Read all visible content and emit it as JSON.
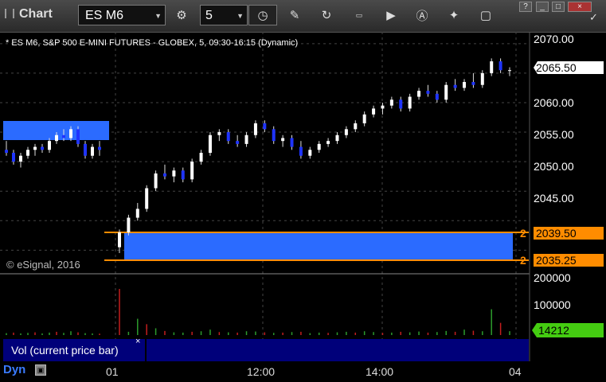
{
  "app": {
    "title": "Chart"
  },
  "toolbar": {
    "symbol": "ES M6",
    "interval": "5",
    "icons": [
      "settings-icon",
      "clock-icon",
      "draw-pencil-icon",
      "refresh-icon",
      "get-icon",
      "play-icon",
      "alert-icon",
      "tools-icon",
      "comment-icon",
      "twitter-icon"
    ]
  },
  "window_controls": [
    "?",
    "_",
    "□",
    "×"
  ],
  "chart": {
    "label": "* ES M6, S&P 500 E-MINI FUTURES - GLOBEX, 5, 09:30-16:15 (Dynamic)",
    "copyright": "© eSignal, 2016",
    "price_ticks": [
      "2070.00",
      "2060.00",
      "2055.00",
      "2050.00",
      "2045.00"
    ],
    "current_price": "2065.50",
    "order_upper": {
      "qty": "2",
      "price": "2039.50"
    },
    "order_lower": {
      "qty": "2",
      "price": "2035.25"
    },
    "vol_ticks": [
      "200000",
      "100000"
    ],
    "vol_current": "14212",
    "vol_study_label": "Vol (current price bar)",
    "vol_close_glyph": "×",
    "time_labels": [
      "01",
      "12:00",
      "14:00",
      "04"
    ],
    "dyn_label": "Dyn",
    "colors": {
      "up": "#ffffff",
      "down": "#1f34ff",
      "zone": "#2b6bff",
      "order_line": "#ff8c00",
      "vol_green": "#2c9c2c",
      "vol_red": "#c41e1e"
    }
  },
  "chart_data": {
    "type": "candlestick",
    "ylim": [
      2031,
      2072
    ],
    "bars": [
      [
        2052.0,
        2053.5,
        2051.0,
        2051.5
      ],
      [
        2051.5,
        2052.0,
        2049.5,
        2050.0
      ],
      [
        2050.0,
        2051.5,
        2049.0,
        2051.0
      ],
      [
        2051.0,
        2052.5,
        2050.5,
        2052.0
      ],
      [
        2052.0,
        2053.0,
        2051.0,
        2052.5
      ],
      [
        2052.5,
        2053.0,
        2051.5,
        2052.0
      ],
      [
        2052.0,
        2054.0,
        2051.5,
        2053.5
      ],
      [
        2053.5,
        2055.0,
        2053.0,
        2054.5
      ],
      [
        2054.5,
        2055.5,
        2053.5,
        2054.0
      ],
      [
        2054.0,
        2056.0,
        2053.5,
        2055.5
      ],
      [
        2055.5,
        2056.0,
        2052.5,
        2053.0
      ],
      [
        2053.0,
        2053.5,
        2050.5,
        2051.0
      ],
      [
        2051.0,
        2053.0,
        2050.5,
        2052.5
      ],
      [
        2052.5,
        2053.5,
        2051.0,
        2052.0
      ],
      [
        2035.5,
        2038.5,
        2034.5,
        2038.0
      ],
      [
        2038.0,
        2041.0,
        2037.5,
        2040.5
      ],
      [
        2040.5,
        2043.0,
        2040.0,
        2042.0
      ],
      [
        2042.0,
        2046.0,
        2041.5,
        2045.5
      ],
      [
        2045.5,
        2048.5,
        2045.0,
        2048.0
      ],
      [
        2048.0,
        2049.5,
        2047.0,
        2047.5
      ],
      [
        2047.5,
        2049.0,
        2046.5,
        2048.5
      ],
      [
        2048.5,
        2049.0,
        2046.5,
        2047.0
      ],
      [
        2047.0,
        2050.5,
        2046.5,
        2050.0
      ],
      [
        2050.0,
        2052.0,
        2049.5,
        2051.5
      ],
      [
        2051.5,
        2055.0,
        2051.0,
        2054.5
      ],
      [
        2054.5,
        2055.5,
        2053.5,
        2055.0
      ],
      [
        2055.0,
        2055.5,
        2053.0,
        2053.5
      ],
      [
        2053.5,
        2054.5,
        2052.5,
        2053.0
      ],
      [
        2053.0,
        2055.0,
        2052.5,
        2054.5
      ],
      [
        2054.5,
        2057.0,
        2054.0,
        2056.5
      ],
      [
        2056.5,
        2057.0,
        2055.0,
        2055.5
      ],
      [
        2055.5,
        2056.0,
        2053.0,
        2053.5
      ],
      [
        2053.5,
        2054.5,
        2052.5,
        2054.0
      ],
      [
        2054.0,
        2054.5,
        2052.0,
        2052.5
      ],
      [
        2052.5,
        2053.5,
        2050.5,
        2051.0
      ],
      [
        2051.0,
        2052.5,
        2050.5,
        2052.0
      ],
      [
        2052.0,
        2053.5,
        2051.5,
        2053.0
      ],
      [
        2053.0,
        2054.0,
        2052.5,
        2053.5
      ],
      [
        2053.5,
        2055.0,
        2053.0,
        2054.5
      ],
      [
        2054.5,
        2056.0,
        2054.0,
        2055.5
      ],
      [
        2055.5,
        2057.0,
        2055.0,
        2056.5
      ],
      [
        2056.5,
        2058.5,
        2056.0,
        2058.0
      ],
      [
        2058.0,
        2059.5,
        2057.5,
        2059.0
      ],
      [
        2059.0,
        2060.0,
        2058.0,
        2059.5
      ],
      [
        2059.5,
        2061.0,
        2059.0,
        2060.5
      ],
      [
        2060.5,
        2061.0,
        2058.5,
        2059.0
      ],
      [
        2059.0,
        2061.5,
        2058.5,
        2061.0
      ],
      [
        2061.0,
        2062.5,
        2060.5,
        2062.0
      ],
      [
        2062.0,
        2063.0,
        2061.0,
        2061.5
      ],
      [
        2061.5,
        2062.0,
        2060.0,
        2060.5
      ],
      [
        2060.5,
        2063.5,
        2060.0,
        2063.0
      ],
      [
        2063.0,
        2064.0,
        2062.0,
        2062.5
      ],
      [
        2062.5,
        2064.0,
        2062.0,
        2063.5
      ],
      [
        2063.5,
        2065.0,
        2062.5,
        2063.0
      ],
      [
        2063.0,
        2065.5,
        2062.5,
        2065.0
      ],
      [
        2065.0,
        2067.5,
        2064.5,
        2067.0
      ],
      [
        2067.0,
        2067.5,
        2065.0,
        2065.5
      ],
      [
        2065.5,
        2066.0,
        2064.5,
        2065.5
      ]
    ],
    "volume": [
      [
        7000,
        "g"
      ],
      [
        9000,
        "r"
      ],
      [
        6000,
        "g"
      ],
      [
        8000,
        "g"
      ],
      [
        10000,
        "r"
      ],
      [
        6000,
        "g"
      ],
      [
        9000,
        "g"
      ],
      [
        12000,
        "r"
      ],
      [
        8000,
        "g"
      ],
      [
        14000,
        "g"
      ],
      [
        10000,
        "r"
      ],
      [
        7000,
        "g"
      ],
      [
        6000,
        "g"
      ],
      [
        5000,
        "r"
      ],
      [
        170000,
        "r"
      ],
      [
        12000,
        "g"
      ],
      [
        60000,
        "g"
      ],
      [
        40000,
        "r"
      ],
      [
        25000,
        "g"
      ],
      [
        15000,
        "r"
      ],
      [
        10000,
        "g"
      ],
      [
        9000,
        "g"
      ],
      [
        12000,
        "r"
      ],
      [
        14000,
        "g"
      ],
      [
        20000,
        "g"
      ],
      [
        11000,
        "r"
      ],
      [
        10000,
        "g"
      ],
      [
        9000,
        "r"
      ],
      [
        14000,
        "g"
      ],
      [
        13000,
        "g"
      ],
      [
        10000,
        "r"
      ],
      [
        8000,
        "g"
      ],
      [
        9000,
        "r"
      ],
      [
        11000,
        "g"
      ],
      [
        12000,
        "r"
      ],
      [
        7000,
        "g"
      ],
      [
        9000,
        "g"
      ],
      [
        8000,
        "r"
      ],
      [
        10000,
        "g"
      ],
      [
        12000,
        "g"
      ],
      [
        9000,
        "r"
      ],
      [
        14000,
        "g"
      ],
      [
        11000,
        "g"
      ],
      [
        8000,
        "r"
      ],
      [
        9000,
        "g"
      ],
      [
        12000,
        "r"
      ],
      [
        10000,
        "g"
      ],
      [
        13000,
        "g"
      ],
      [
        9000,
        "r"
      ],
      [
        11000,
        "g"
      ],
      [
        15000,
        "g"
      ],
      [
        12000,
        "r"
      ],
      [
        20000,
        "g"
      ],
      [
        16000,
        "r"
      ],
      [
        14000,
        "g"
      ],
      [
        95000,
        "g"
      ],
      [
        45000,
        "r"
      ],
      [
        14212,
        "g"
      ]
    ]
  }
}
